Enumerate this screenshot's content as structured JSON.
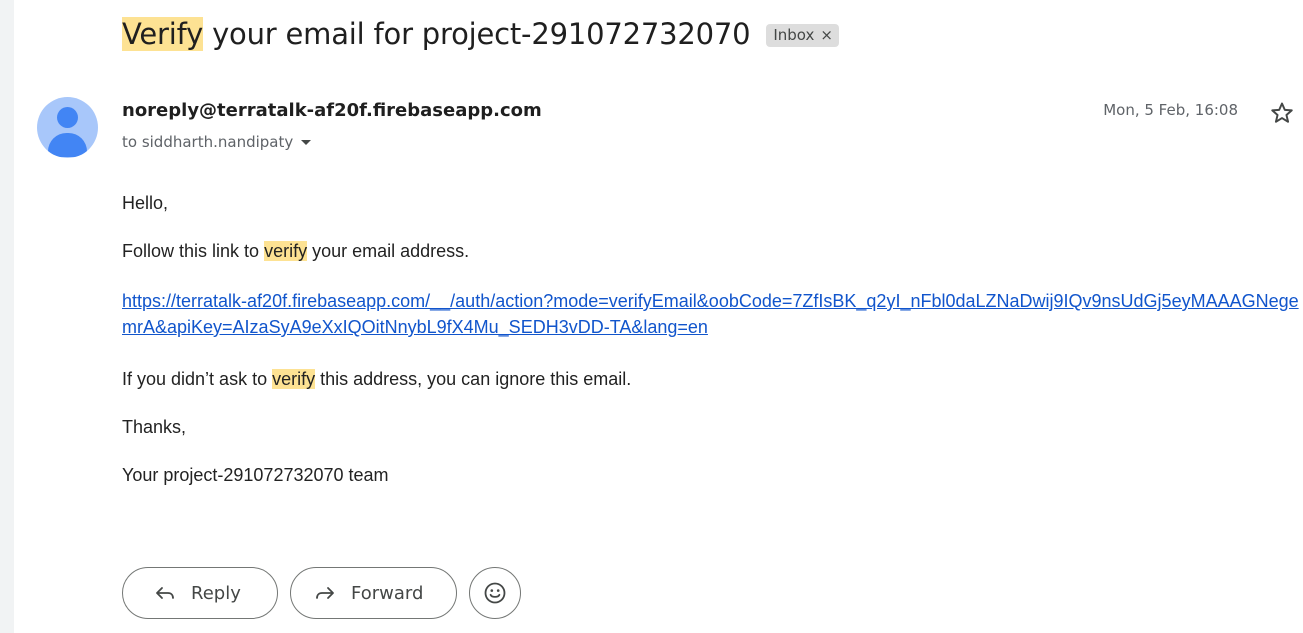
{
  "email": {
    "subject_highlight": "Verify",
    "subject_rest": " your email for project-291072732070",
    "label": "Inbox",
    "label_remove": "×",
    "sender": "noreply@terratalk-af20f.firebaseapp.com",
    "recipient": "to siddharth.nandipaty",
    "date": "Mon, 5 Feb, 16:08"
  },
  "body": {
    "greeting": "Hello,",
    "follow_before": "Follow this link to ",
    "follow_highlight": "verify",
    "follow_after": " your email address.",
    "link": "https://terratalk-af20f.firebaseapp.com/__/auth/action?mode=verifyEmail&oobCode=7ZfIsBK_q2yI_nFbl0daLZNaDwij9IQv9nsUdGj5eyMAAAGNegemrA&apiKey=AIzaSyA9eXxIQOitNnybL9fX4Mu_SEDH3vDD-TA&lang=en",
    "ignore_before": "If you didn’t ask to ",
    "ignore_highlight": "verify",
    "ignore_after": " this address, you can ignore this email.",
    "thanks": "Thanks,",
    "signature": "Your project-291072732070 team"
  },
  "actions": {
    "reply": "Reply",
    "forward": "Forward"
  },
  "icons": {
    "avatar": "default-person-avatar",
    "star": "star-outline-icon",
    "reply": "reply-arrow-icon",
    "forward": "forward-arrow-icon",
    "emoji": "smiley-emoji-icon",
    "dropdown": "caret-down-icon"
  },
  "colors": {
    "highlight": "#fde293",
    "link": "#1155cc",
    "avatar_bg": "#a8c7fa",
    "avatar_fg": "#4285f4",
    "label_chip": "#dddddd"
  }
}
